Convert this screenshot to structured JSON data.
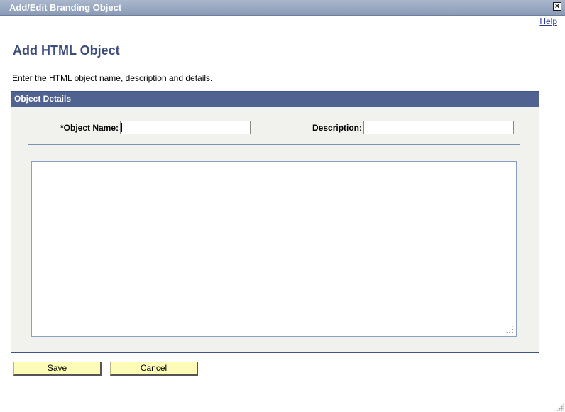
{
  "window": {
    "title": "Add/Edit Branding Object",
    "close_symbol": "×"
  },
  "help_link": "Help",
  "page_title": "Add HTML Object",
  "instructions": "Enter the HTML object name, description and details.",
  "group": {
    "header": "Object Details",
    "object_name": {
      "label": "*Object Name:",
      "value": ""
    },
    "description": {
      "label": "Description:",
      "value": ""
    },
    "details": {
      "value": ""
    }
  },
  "buttons": {
    "save": "Save",
    "cancel": "Cancel"
  },
  "icons": {
    "close": "close-icon",
    "resize": "resize-grip-icon"
  }
}
